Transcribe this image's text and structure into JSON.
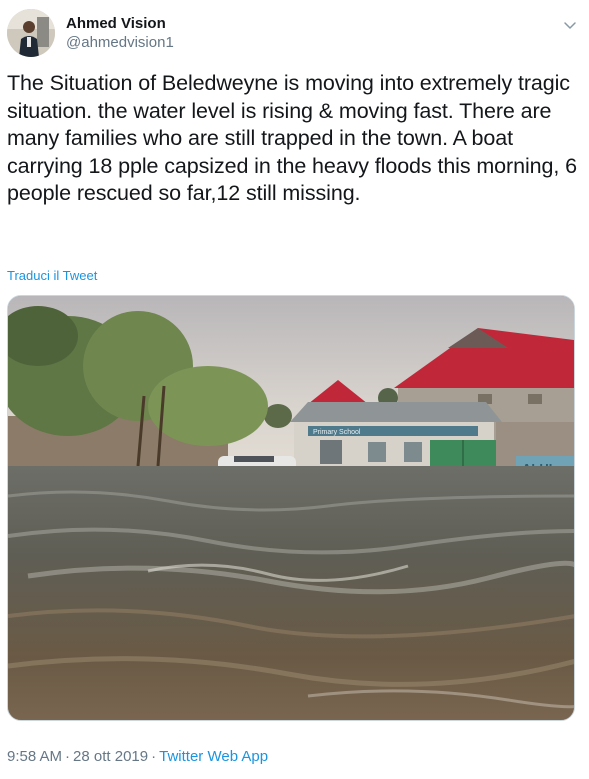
{
  "tweet": {
    "author": {
      "display_name": "Ahmed Vision",
      "handle": "@ahmedvision1"
    },
    "text": "The Situation of Beledweyne is moving into extremely tragic situation. the water level is rising & moving fast. There are many families who are still trapped in the town. A boat carrying 18 pple capsized in the heavy floods this morning, 6 people rescued so far,12 still missing.",
    "translate_label": "Traduci il Tweet",
    "media": {
      "sign_text": "ALHI",
      "banner_text": "Primary School"
    },
    "time": "9:58 AM",
    "date": "28 ott 2019",
    "separator": "·",
    "source": "Twitter Web App"
  },
  "colors": {
    "link": "#1b95e0",
    "secondary_text": "#657786",
    "primary_text": "#14171a",
    "roof_red": "#c0283a"
  },
  "icons": {
    "menu": "chevron-down-icon"
  }
}
